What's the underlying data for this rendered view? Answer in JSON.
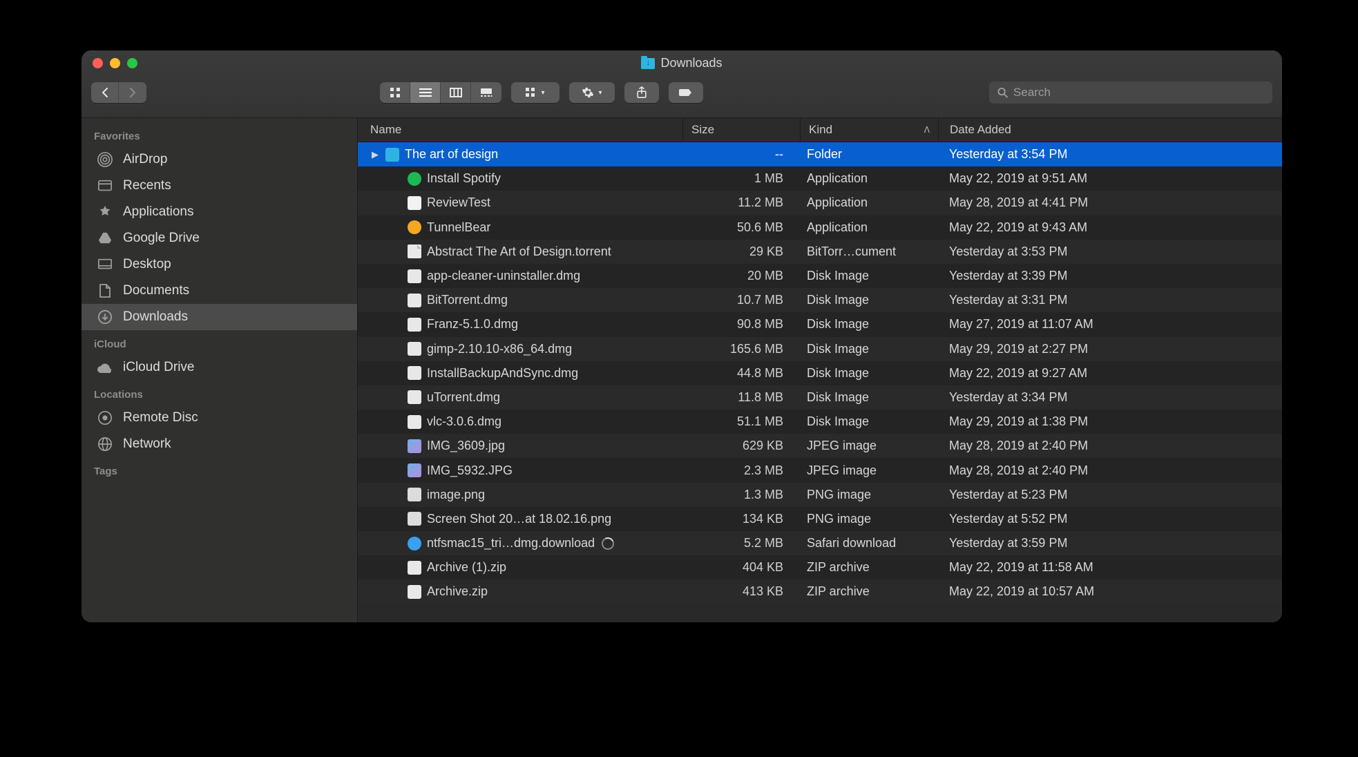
{
  "window": {
    "title": "Downloads"
  },
  "toolbar": {
    "search_placeholder": "Search"
  },
  "sidebar": {
    "sections": [
      {
        "heading": "Favorites",
        "items": [
          {
            "label": "AirDrop",
            "icon": "airdrop"
          },
          {
            "label": "Recents",
            "icon": "recents"
          },
          {
            "label": "Applications",
            "icon": "applications"
          },
          {
            "label": "Google Drive",
            "icon": "gdrive"
          },
          {
            "label": "Desktop",
            "icon": "desktop"
          },
          {
            "label": "Documents",
            "icon": "documents"
          },
          {
            "label": "Downloads",
            "icon": "downloads",
            "selected": true
          }
        ]
      },
      {
        "heading": "iCloud",
        "items": [
          {
            "label": "iCloud Drive",
            "icon": "icloud"
          }
        ]
      },
      {
        "heading": "Locations",
        "items": [
          {
            "label": "Remote Disc",
            "icon": "remotedisc"
          },
          {
            "label": "Network",
            "icon": "network"
          }
        ]
      },
      {
        "heading": "Tags",
        "items": []
      }
    ]
  },
  "columns": {
    "name": "Name",
    "size": "Size",
    "kind": "Kind",
    "date": "Date Added",
    "sort_column": "kind",
    "sort_dir": "asc"
  },
  "files": [
    {
      "name": "The art of design",
      "size": "--",
      "kind": "Folder",
      "date": "Yesterday at 3:54 PM",
      "icon": "folder",
      "selected": true,
      "expandable": true
    },
    {
      "name": "Install Spotify",
      "size": "1 MB",
      "kind": "Application",
      "date": "May 22, 2019 at 9:51 AM",
      "icon": "spotify"
    },
    {
      "name": "ReviewTest",
      "size": "11.2 MB",
      "kind": "Application",
      "date": "May 28, 2019 at 4:41 PM",
      "icon": "app"
    },
    {
      "name": "TunnelBear",
      "size": "50.6 MB",
      "kind": "Application",
      "date": "May 22, 2019 at 9:43 AM",
      "icon": "tunnel"
    },
    {
      "name": "Abstract The Art of Design.torrent",
      "size": "29 KB",
      "kind": "BitTorr…cument",
      "date": "Yesterday at 3:53 PM",
      "icon": "doc"
    },
    {
      "name": "app-cleaner-uninstaller.dmg",
      "size": "20 MB",
      "kind": "Disk Image",
      "date": "Yesterday at 3:39 PM",
      "icon": "dmg"
    },
    {
      "name": "BitTorrent.dmg",
      "size": "10.7 MB",
      "kind": "Disk Image",
      "date": "Yesterday at 3:31 PM",
      "icon": "dmg"
    },
    {
      "name": "Franz-5.1.0.dmg",
      "size": "90.8 MB",
      "kind": "Disk Image",
      "date": "May 27, 2019 at 11:07 AM",
      "icon": "dmg"
    },
    {
      "name": "gimp-2.10.10-x86_64.dmg",
      "size": "165.6 MB",
      "kind": "Disk Image",
      "date": "May 29, 2019 at 2:27 PM",
      "icon": "dmg"
    },
    {
      "name": "InstallBackupAndSync.dmg",
      "size": "44.8 MB",
      "kind": "Disk Image",
      "date": "May 22, 2019 at 9:27 AM",
      "icon": "dmg"
    },
    {
      "name": "uTorrent.dmg",
      "size": "11.8 MB",
      "kind": "Disk Image",
      "date": "Yesterday at 3:34 PM",
      "icon": "dmg"
    },
    {
      "name": "vlc-3.0.6.dmg",
      "size": "51.1 MB",
      "kind": "Disk Image",
      "date": "May 29, 2019 at 1:38 PM",
      "icon": "dmg"
    },
    {
      "name": "IMG_3609.jpg",
      "size": "629 KB",
      "kind": "JPEG image",
      "date": "May 28, 2019 at 2:40 PM",
      "icon": "img"
    },
    {
      "name": "IMG_5932.JPG",
      "size": "2.3 MB",
      "kind": "JPEG image",
      "date": "May 28, 2019 at 2:40 PM",
      "icon": "img"
    },
    {
      "name": "image.png",
      "size": "1.3 MB",
      "kind": "PNG image",
      "date": "Yesterday at 5:23 PM",
      "icon": "png"
    },
    {
      "name": "Screen Shot 20…at 18.02.16.png",
      "size": "134 KB",
      "kind": "PNG image",
      "date": "Yesterday at 5:52 PM",
      "icon": "png"
    },
    {
      "name": "ntfsmac15_tri…dmg.download",
      "size": "5.2 MB",
      "kind": "Safari download",
      "date": "Yesterday at 3:59 PM",
      "icon": "dl",
      "progress": true
    },
    {
      "name": "Archive (1).zip",
      "size": "404 KB",
      "kind": "ZIP archive",
      "date": "May 22, 2019 at 11:58 AM",
      "icon": "zip"
    },
    {
      "name": "Archive.zip",
      "size": "413 KB",
      "kind": "ZIP archive",
      "date": "May 22, 2019 at 10:57 AM",
      "icon": "zip"
    }
  ]
}
